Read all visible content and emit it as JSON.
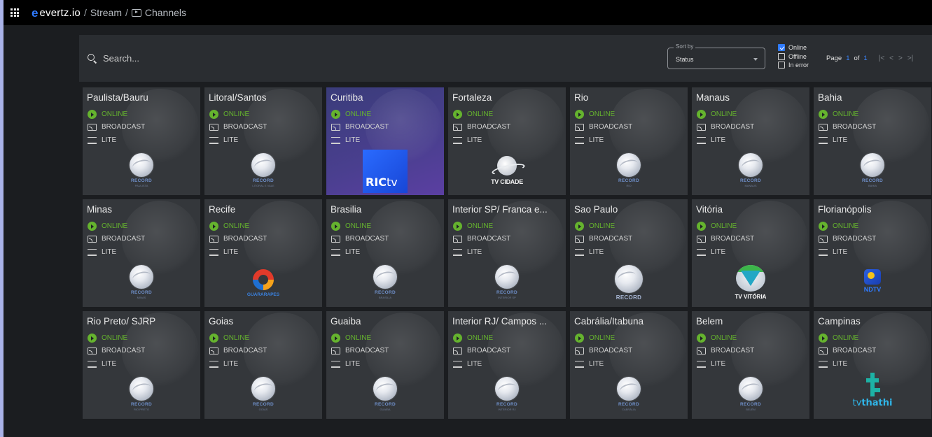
{
  "topbar": {
    "brand": "evertz.io",
    "brand_mark": "e",
    "crumbs": [
      "Stream",
      "Channels"
    ],
    "separator": "/"
  },
  "filters": {
    "search_placeholder": "Search...",
    "sort_label": "Sort by",
    "sort_value": "Status",
    "checks": [
      {
        "label": "Online",
        "checked": true
      },
      {
        "label": "Offline",
        "checked": false
      },
      {
        "label": "In error",
        "checked": false
      }
    ],
    "pager": {
      "page_word": "Page",
      "current": "1",
      "of_word": "of",
      "total": "1"
    }
  },
  "icons": {
    "play": "play-circle-icon",
    "cast": "cast-icon",
    "lite": "lines-icon",
    "grid": "grid-menu-icon",
    "search": "search-icon",
    "channels": "play-box-icon"
  },
  "colors": {
    "accent": "#2f7bff",
    "online": "#65b32e"
  },
  "channels": [
    {
      "name": "Paulista/Bauru",
      "status": "ONLINE",
      "type": "BROADCAST",
      "tier": "LITE",
      "logo": "record",
      "logo_text": "RECORD",
      "logo_sub": "PAULISTA"
    },
    {
      "name": "Litoral/Santos",
      "status": "ONLINE",
      "type": "BROADCAST",
      "tier": "LITE",
      "logo": "record",
      "logo_text": "RECORD",
      "logo_sub": "LITORAL E VALE"
    },
    {
      "name": "Curitiba",
      "status": "ONLINE",
      "type": "BROADCAST",
      "tier": "LITE",
      "logo": "ric",
      "logo_text": "RIC",
      "logo_sub": "tv"
    },
    {
      "name": "Fortaleza",
      "status": "ONLINE",
      "type": "BROADCAST",
      "tier": "LITE",
      "logo": "cidade",
      "logo_text": "TV CIDADE",
      "logo_sub": ""
    },
    {
      "name": "Rio",
      "status": "ONLINE",
      "type": "BROADCAST",
      "tier": "LITE",
      "logo": "record",
      "logo_text": "RECORD",
      "logo_sub": "RIO"
    },
    {
      "name": "Manaus",
      "status": "ONLINE",
      "type": "BROADCAST",
      "tier": "LITE",
      "logo": "record",
      "logo_text": "RECORD",
      "logo_sub": "MANAUS"
    },
    {
      "name": "Bahia",
      "status": "ONLINE",
      "type": "BROADCAST",
      "tier": "LITE",
      "logo": "record",
      "logo_text": "RECORD",
      "logo_sub": "BAHIA"
    },
    {
      "name": "Minas",
      "status": "ONLINE",
      "type": "BROADCAST",
      "tier": "LITE",
      "logo": "record",
      "logo_text": "RECORD",
      "logo_sub": "MINAS"
    },
    {
      "name": "Recife",
      "status": "ONLINE",
      "type": "BROADCAST",
      "tier": "LITE",
      "logo": "guara",
      "logo_text": "GUARARAPES",
      "logo_sub": ""
    },
    {
      "name": "Brasilia",
      "status": "ONLINE",
      "type": "BROADCAST",
      "tier": "LITE",
      "logo": "record",
      "logo_text": "RECORD",
      "logo_sub": "BRASÍLIA"
    },
    {
      "name": "Interior SP/ Franca e...",
      "status": "ONLINE",
      "type": "BROADCAST",
      "tier": "LITE",
      "logo": "record",
      "logo_text": "RECORD",
      "logo_sub": "INTERIOR SP"
    },
    {
      "name": "Sao Paulo",
      "status": "ONLINE",
      "type": "BROADCAST",
      "tier": "LITE",
      "logo": "record-big",
      "logo_text": "RECORD",
      "logo_sub": ""
    },
    {
      "name": "Vitória",
      "status": "ONLINE",
      "type": "BROADCAST",
      "tier": "LITE",
      "logo": "vitoria",
      "logo_text": "TV VITÓRIA",
      "logo_sub": ""
    },
    {
      "name": "Florianópolis",
      "status": "ONLINE",
      "type": "BROADCAST",
      "tier": "LITE",
      "logo": "ndtv",
      "logo_text": "NDTV",
      "logo_sub": ""
    },
    {
      "name": "Rio Preto/ SJRP",
      "status": "ONLINE",
      "type": "BROADCAST",
      "tier": "LITE",
      "logo": "record",
      "logo_text": "RECORD",
      "logo_sub": "RIO PRETO"
    },
    {
      "name": "Goias",
      "status": "ONLINE",
      "type": "BROADCAST",
      "tier": "LITE",
      "logo": "record",
      "logo_text": "RECORD",
      "logo_sub": "GOIÁS"
    },
    {
      "name": "Guaiba",
      "status": "ONLINE",
      "type": "BROADCAST",
      "tier": "LITE",
      "logo": "record",
      "logo_text": "RECORD",
      "logo_sub": "GUAÍBA"
    },
    {
      "name": "Interior RJ/ Campos ...",
      "status": "ONLINE",
      "type": "BROADCAST",
      "tier": "LITE",
      "logo": "record",
      "logo_text": "RECORD",
      "logo_sub": "INTERIOR RJ"
    },
    {
      "name": "Cabrália/Itabuna",
      "status": "ONLINE",
      "type": "BROADCAST",
      "tier": "LITE",
      "logo": "record",
      "logo_text": "RECORD",
      "logo_sub": "CABRÁLIA"
    },
    {
      "name": "Belem",
      "status": "ONLINE",
      "type": "BROADCAST",
      "tier": "LITE",
      "logo": "record",
      "logo_text": "RECORD",
      "logo_sub": "BELÉM"
    },
    {
      "name": "Campinas",
      "status": "ONLINE",
      "type": "BROADCAST",
      "tier": "LITE",
      "logo": "thathi",
      "logo_text": "thathi",
      "logo_sub": "tv"
    }
  ]
}
